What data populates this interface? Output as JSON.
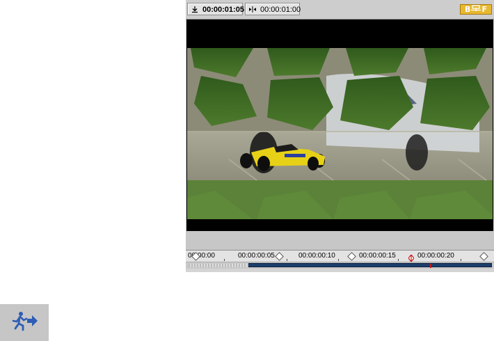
{
  "toolbar": {
    "position_timecode": "00:00:01:05",
    "duration_timecode": "00:00:01:00",
    "badge": {
      "left": "B",
      "right": "F"
    }
  },
  "timeline": {
    "labels": [
      "00:00:00",
      "00:00:00:05",
      "00:00:00:10",
      "00:00:00:15",
      "00:00:00:20"
    ],
    "accent": "#c81818"
  },
  "icons": {
    "position": "download-icon",
    "duration": "trim-icon",
    "run": "runner-arrow-icon"
  },
  "colors": {
    "badge": "#e8b830",
    "scroll_thumb": "#1d3e6b"
  }
}
